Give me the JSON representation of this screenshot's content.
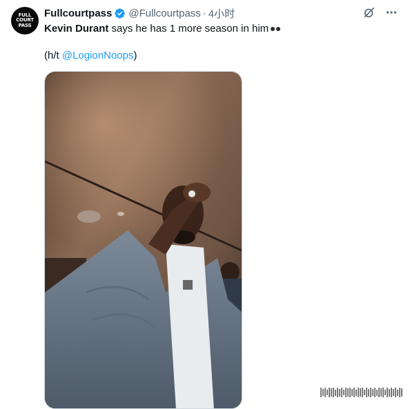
{
  "author": {
    "avatar_text": [
      "FULL",
      "COURT",
      "PASS"
    ],
    "name": "Fullcourtpass",
    "handle": "@Fullcourtpass",
    "separator": "·",
    "time": "4小时"
  },
  "tweet": {
    "mention_bold": "Kevin Durant",
    "text_rest": " says he has 1 more season in him",
    "emoji": "eyes",
    "hat_tip_prefix": "(h/t ",
    "hat_tip_mention": "@LogionNoops",
    "hat_tip_suffix": ")"
  },
  "icons": {
    "verified": "verified-badge-icon",
    "grok": "grok-icon",
    "more": "more-icon"
  },
  "colors": {
    "accent": "#1d9bf0",
    "text": "#0f1419",
    "secondary": "#536471"
  }
}
